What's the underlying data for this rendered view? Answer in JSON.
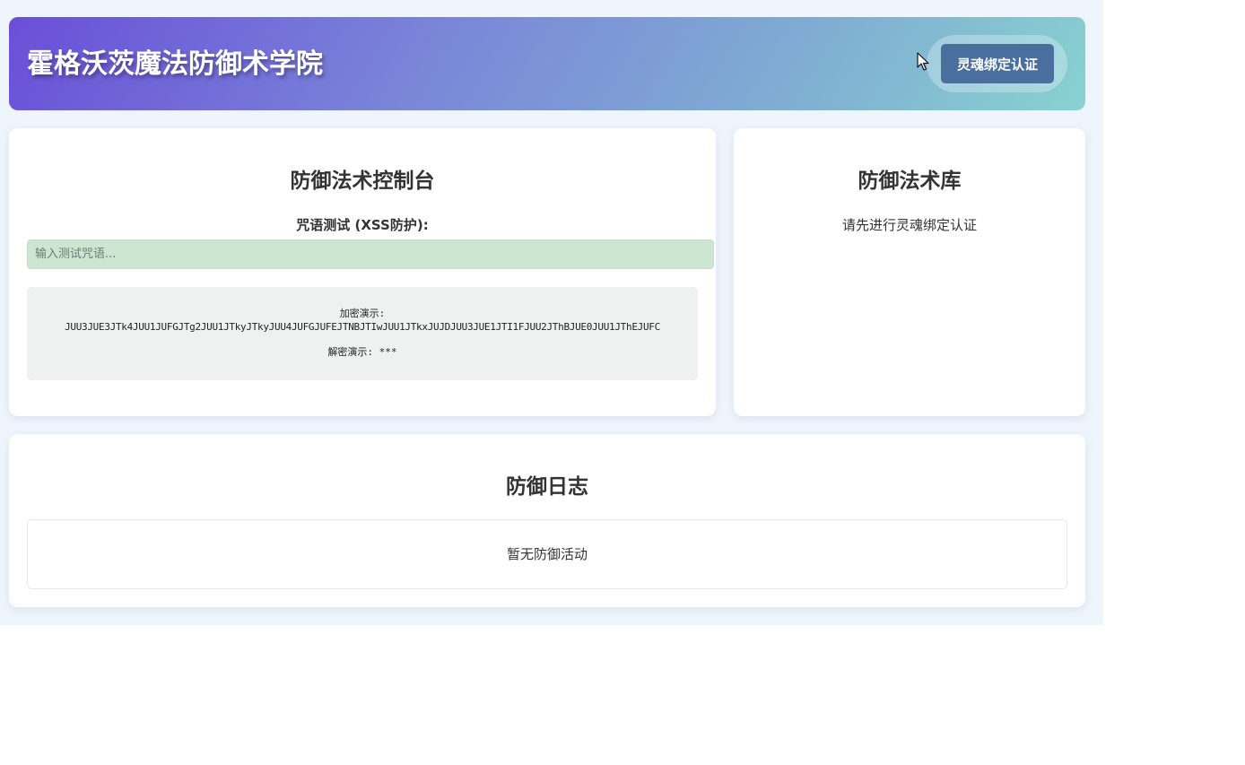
{
  "header": {
    "title": "霍格沃茨魔法防御术学院",
    "auth_button": "灵魂绑定认证"
  },
  "console": {
    "title": "防御法术控制台",
    "spell_label": "咒语测试 (XSS防护):",
    "spell_input_placeholder": "输入测试咒语...",
    "spell_input_value": "",
    "encrypt_label": "加密演示:",
    "encrypt_value": "JUU3JUE3JTk4JUU1JUFGJTg2JUU1JTkyJTkyJUU4JUFGJUFEJTNBJTIwJUU1JTkxJUJDJUU3JUE1JTI1FJUU2JThBJUE0JUU1JThEJUFC",
    "decrypt_line": "解密演示: ***"
  },
  "library": {
    "title": "防御法术库",
    "message": "请先进行灵魂绑定认证"
  },
  "log": {
    "title": "防御日志",
    "empty_text": "暂无防御活动"
  },
  "colors": {
    "header_gradient_start": "#6a4fd8",
    "header_gradient_end": "#88d2d0",
    "auth_button_bg": "#4a6e9e",
    "input_bg": "#cde6d1",
    "page_bg": "#eef5fd"
  },
  "icons": {
    "cursor": "mouse-pointer-icon"
  }
}
